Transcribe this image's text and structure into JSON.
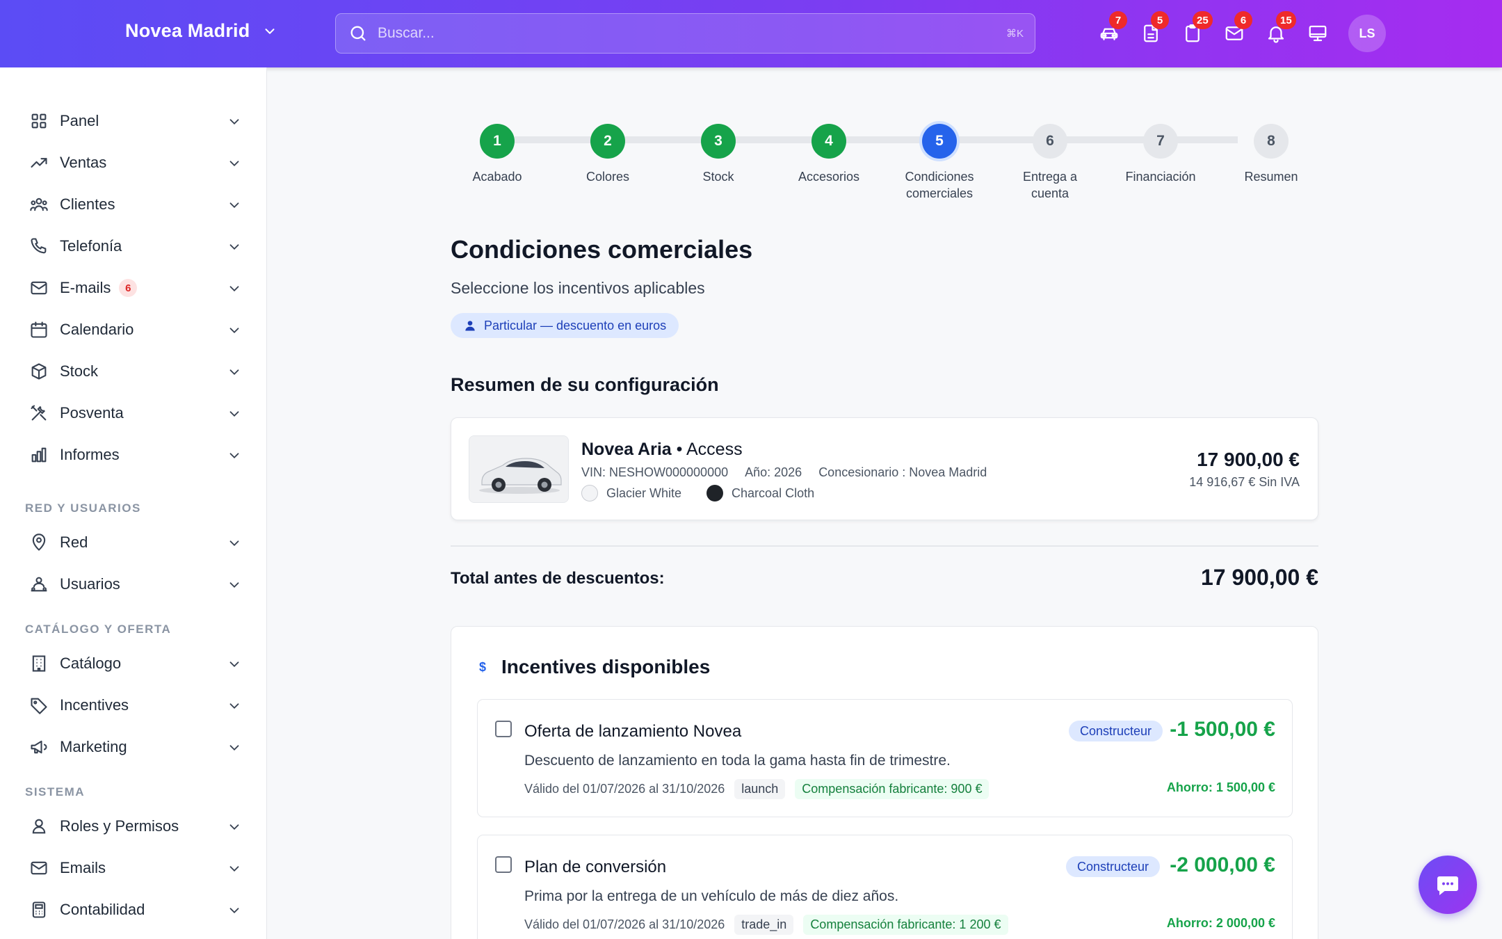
{
  "topbar": {
    "brand": "Novea Madrid",
    "search_placeholder": "Buscar...",
    "search_shortcut": "⌘K",
    "icons": [
      {
        "name": "car-icon",
        "badge": "7"
      },
      {
        "name": "document-icon",
        "badge": "5"
      },
      {
        "name": "clipboard-icon",
        "badge": "25"
      },
      {
        "name": "mail-icon",
        "badge": "6"
      },
      {
        "name": "bell-icon",
        "badge": "15"
      },
      {
        "name": "monitor-icon",
        "badge": ""
      }
    ],
    "avatar_initials": "LS"
  },
  "sidebar": {
    "items": [
      {
        "label": "Panel",
        "icon": "grid-icon"
      },
      {
        "label": "Ventas",
        "icon": "trending-up-icon"
      },
      {
        "label": "Clientes",
        "icon": "users-icon"
      },
      {
        "label": "Telefonía",
        "icon": "phone-icon"
      },
      {
        "label": "E-mails",
        "icon": "mail-icon",
        "count": "6"
      },
      {
        "label": "Calendario",
        "icon": "calendar-icon"
      },
      {
        "label": "Stock",
        "icon": "box-icon"
      },
      {
        "label": "Posventa",
        "icon": "tools-icon"
      },
      {
        "label": "Informes",
        "icon": "chart-icon"
      }
    ],
    "section_network": "RED Y USUARIOS",
    "network_items": [
      {
        "label": "Red",
        "icon": "map-pin-icon"
      },
      {
        "label": "Usuarios",
        "icon": "user-group-icon"
      }
    ],
    "section_catalog": "CATÁLOGO Y OFERTA",
    "catalog_items": [
      {
        "label": "Catálogo",
        "icon": "building-icon"
      },
      {
        "label": "Incentives",
        "icon": "tag-icon"
      },
      {
        "label": "Marketing",
        "icon": "megaphone-icon"
      }
    ],
    "section_system": "SISTEMA",
    "system_items": [
      {
        "label": "Roles y Permisos",
        "icon": "user-icon"
      },
      {
        "label": "Emails",
        "icon": "mail-icon"
      },
      {
        "label": "Contabilidad",
        "icon": "calculator-icon"
      }
    ]
  },
  "stepper": {
    "steps": [
      {
        "num": "1",
        "label": "Acabado",
        "state": "done"
      },
      {
        "num": "2",
        "label": "Colores",
        "state": "done"
      },
      {
        "num": "3",
        "label": "Stock",
        "state": "done"
      },
      {
        "num": "4",
        "label": "Accesorios",
        "state": "done"
      },
      {
        "num": "5",
        "label": "Condiciones comerciales",
        "state": "current"
      },
      {
        "num": "6",
        "label": "Entrega a cuenta",
        "state": "todo"
      },
      {
        "num": "7",
        "label": "Financiación",
        "state": "todo"
      },
      {
        "num": "8",
        "label": "Resumen",
        "state": "todo"
      }
    ]
  },
  "main": {
    "title": "Condiciones comerciales",
    "subtitle": "Seleccione los incentivos aplicables",
    "client_type": "Particular — descuento en euros",
    "summary_title": "Resumen de su configuración",
    "car": {
      "model": "Novea Aria",
      "separator": "•",
      "trim": "Access",
      "vin": "VIN: NESHOW000000000",
      "year": "Año: 2026",
      "dealer": "Concesionario : Novea Madrid",
      "exterior_color": "Glacier White",
      "interior_color": "Charcoal Cloth",
      "price": "17 900,00 €",
      "price_no_vat": "14 916,67 € Sin IVA"
    },
    "total_label": "Total antes de descuentos:",
    "total_value": "17 900,00 €",
    "incentives_title": "Incentives disponibles",
    "incentives": [
      {
        "name": "Oferta de lanzamiento Novea",
        "source": "Constructeur",
        "amount": "-1 500,00 €",
        "description": "Descuento de lanzamiento en toda la gama hasta fin de trimestre.",
        "validity": "Válido del 01/07/2026 al 31/10/2026",
        "tag": "launch",
        "compensation": "Compensación fabricante: 900 €",
        "saving": "Ahorro: 1 500,00 €"
      },
      {
        "name": "Plan de conversión",
        "source": "Constructeur",
        "amount": "-2 000,00 €",
        "description": "Prima por la entrega de un vehículo de más de diez años.",
        "validity": "Válido del 01/07/2026 al 31/10/2026",
        "tag": "trade_in",
        "compensation": "Compensación fabricante: 1 200 €",
        "saving": "Ahorro: 2 000,00 €"
      }
    ]
  },
  "colors": {
    "accent_start": "#5b4cf5",
    "accent_end": "#a62cf0",
    "done": "#16a34a",
    "current": "#2563eb",
    "badge": "#ef2a2a",
    "glacier_white": "#f3f4f6",
    "charcoal_cloth": "#1f2328"
  }
}
